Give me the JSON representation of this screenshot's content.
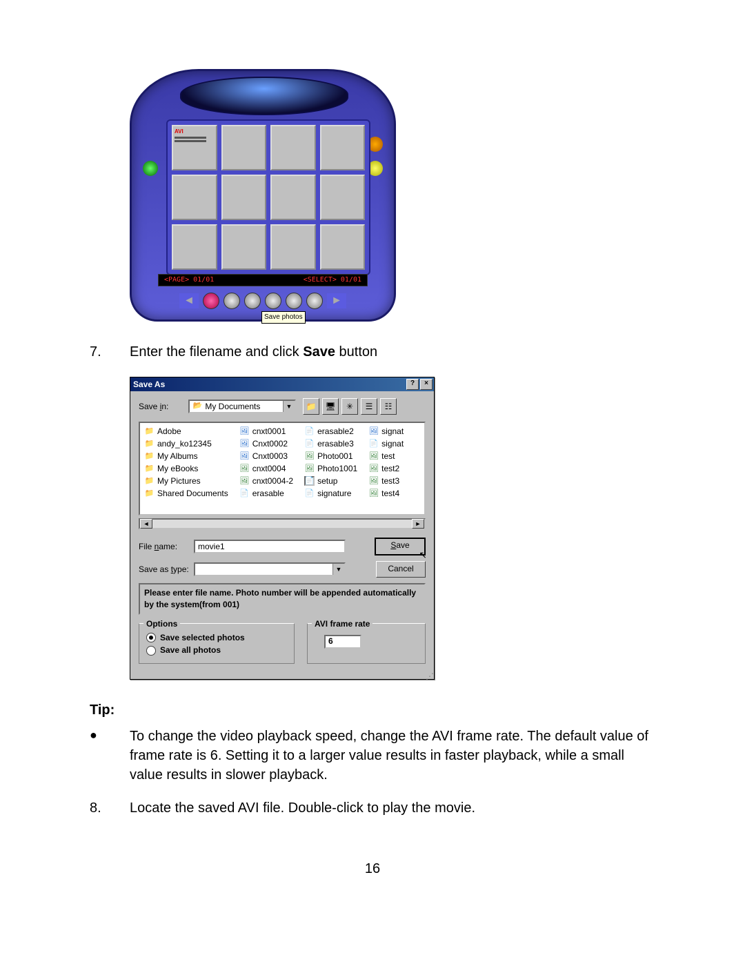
{
  "device": {
    "avi_label": "AVI",
    "page_left": "<PAGE>   01/01",
    "page_right": "<SELECT> 01/01",
    "tooltip": "Save photos"
  },
  "steps": {
    "s7num": "7.",
    "s7a": "Enter the filename and click ",
    "s7b": "Save",
    "s7c": " button",
    "tip_heading": "Tip:",
    "tip_bullet": "●",
    "tip_text": "To change the video playback speed, change the AVI frame rate. The default value of frame rate is 6. Setting it to a larger value results in faster playback, while a small value results in slower playback.",
    "s8num": "8.",
    "s8text": "Locate the saved AVI file. Double-click to play the movie."
  },
  "dialog": {
    "title": "Save As",
    "help_btn": "?",
    "close_btn": "×",
    "savein_label_pre": "Save ",
    "savein_label_u": "i",
    "savein_label_post": "n:",
    "savein_value": "My Documents",
    "icons": {
      "up": "folder-up-icon",
      "desktop": "desktop-icon",
      "newfolder": "new-folder-icon",
      "list": "list-view-icon",
      "details": "details-view-icon"
    },
    "columns": [
      [
        {
          "icon": "folder",
          "name": "Adobe"
        },
        {
          "icon": "folder",
          "name": "andy_ko12345"
        },
        {
          "icon": "folder",
          "name": "My Albums"
        },
        {
          "icon": "folder",
          "name": "My eBooks"
        },
        {
          "icon": "folder",
          "name": "My Pictures"
        },
        {
          "icon": "folder",
          "name": "Shared Documents"
        }
      ],
      [
        {
          "icon": "bmp",
          "name": "cnxt0001"
        },
        {
          "icon": "bmp",
          "name": "Cnxt0002"
        },
        {
          "icon": "bmp",
          "name": "Cnxt0003"
        },
        {
          "icon": "img",
          "name": "cnxt0004"
        },
        {
          "icon": "img",
          "name": "cnxt0004-2"
        },
        {
          "icon": "pdf",
          "name": "erasable"
        }
      ],
      [
        {
          "icon": "pdf",
          "name": "erasable2"
        },
        {
          "icon": "pdf",
          "name": "erasable3"
        },
        {
          "icon": "img",
          "name": "Photo001"
        },
        {
          "icon": "img",
          "name": "Photo1001"
        },
        {
          "icon": "txt",
          "name": "setup"
        },
        {
          "icon": "doc",
          "name": "signature"
        }
      ],
      [
        {
          "icon": "bmp",
          "name": "signat"
        },
        {
          "icon": "pdf",
          "name": "signat"
        },
        {
          "icon": "img",
          "name": "test"
        },
        {
          "icon": "img",
          "name": "test2"
        },
        {
          "icon": "img",
          "name": "test3"
        },
        {
          "icon": "img",
          "name": "test4"
        }
      ]
    ],
    "filename_label_pre": "File ",
    "filename_label_u": "n",
    "filename_label_post": "ame:",
    "filename_value": "movie1",
    "savetype_label_pre": "Save as ",
    "savetype_label_u": "t",
    "savetype_label_post": "ype:",
    "savetype_value": "",
    "save_btn_u": "S",
    "save_btn_rest": "ave",
    "cancel_btn": "Cancel",
    "message": "Please enter file name. Photo number will be appended automatically by the system(from 001)",
    "options_legend": "Options",
    "opt_selected": "Save selected photos",
    "opt_all": "Save all photos",
    "frame_legend": "AVI frame rate",
    "frame_value": "6"
  },
  "page_number": "16"
}
